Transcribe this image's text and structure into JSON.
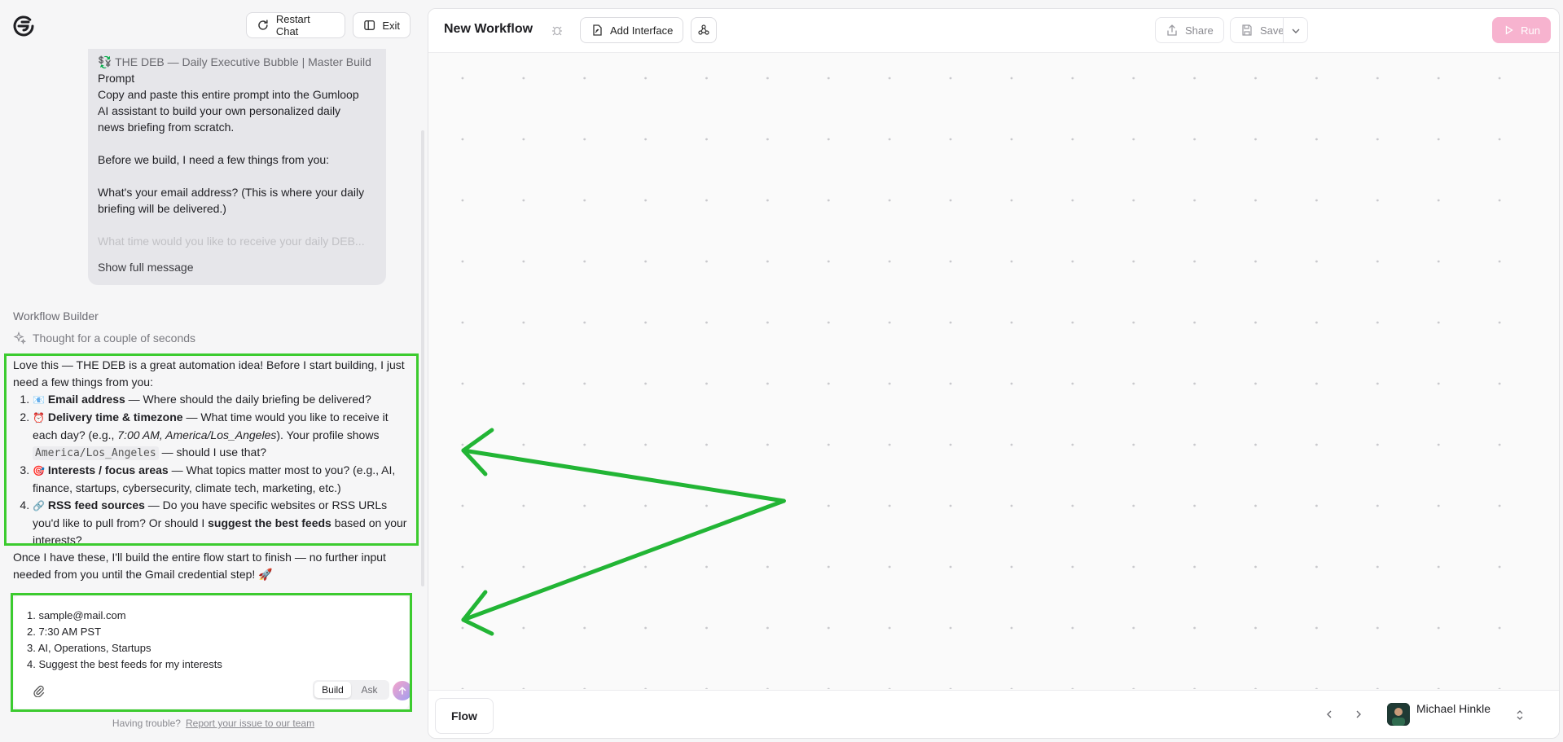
{
  "left_panel": {
    "restart_label": "Restart Chat",
    "exit_label": "Exit",
    "user_message": {
      "line1": "💱 THE DEB — Daily Executive Bubble | Master Build",
      "line2": "Prompt",
      "line3": "Copy and paste this entire prompt into the Gumloop",
      "line4": "AI assistant to build your own personalized daily",
      "line5": "news briefing from scratch.",
      "line6": "Before we build, I need a few things from you:",
      "line7": "What's your email address? (This is where your daily",
      "line8": "briefing will be delivered.)",
      "line9": "What time would you like to receive your daily DEB...",
      "show_full": "Show full message"
    },
    "builder_title": "Workflow Builder",
    "thought": "Thought for a couple of seconds",
    "reply": {
      "intro": "Love this — THE DEB is a great automation idea! Before I start building, I just need a few things from you:",
      "items": [
        {
          "emoji": "📧",
          "bold": "Email address",
          "rest": " — Where should the daily briefing be delivered?"
        },
        {
          "emoji": "⏰",
          "bold": "Delivery time & timezone",
          "rest": " — What time would you like to receive it each day? (e.g., ",
          "italic": "7:00 AM, America/Los_Angeles",
          "rest2": "). Your profile shows ",
          "code": "America/Los_Angeles",
          "rest3": " — should I use that?"
        },
        {
          "emoji": "🎯",
          "bold": "Interests / focus areas",
          "rest": " — What topics matter most to you? (e.g., AI, finance, startups, cybersecurity, climate tech, marketing, etc.)"
        },
        {
          "emoji": "🔗",
          "bold": "RSS feed sources",
          "rest": " — Do you have specific websites or RSS URLs you'd like to pull from? Or should I ",
          "bold2": "suggest the best feeds",
          "rest2": " based on your interests?"
        }
      ],
      "outro": "Once I have these, I'll build the entire flow start to finish — no further input needed from you until the Gmail credential step! 🚀"
    },
    "composer": {
      "lines": [
        "1. sample@mail.com",
        "2. 7:30 AM PST",
        "3. AI, Operations, Startups",
        "4. Suggest the best feeds for my interests"
      ],
      "mode_build": "Build",
      "mode_ask": "Ask",
      "active_mode": "Build"
    },
    "trouble_text": "Having trouble?",
    "trouble_link": "Report your issue to our team"
  },
  "right_panel": {
    "title": "New Workflow",
    "add_interface": "Add Interface",
    "share": "Share",
    "save": "Save",
    "run": "Run",
    "tab_flow": "Flow",
    "user_name": "Michael Hinkle"
  },
  "colors": {
    "highlight": "#3ccb2f",
    "run_button": "#f7b3cf",
    "canvas_bg": "#fafafa"
  }
}
